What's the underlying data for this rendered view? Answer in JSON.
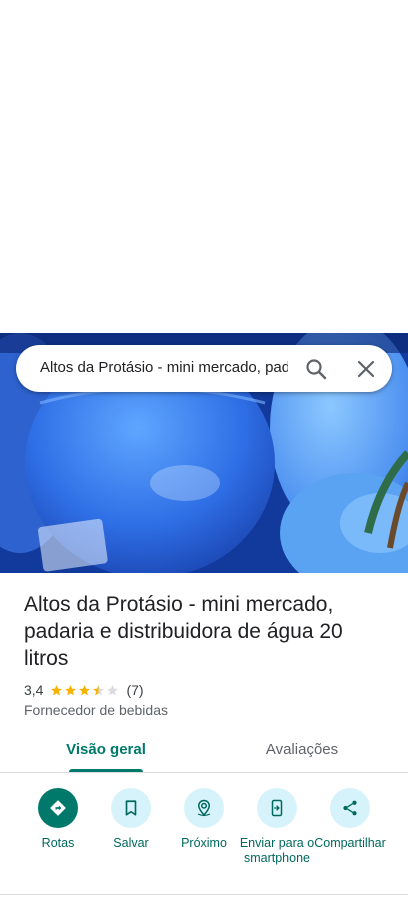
{
  "search": {
    "query": "Altos da Protásio - mini mercado, padaria e distribuidora de água 20 litros",
    "search_icon": "search-icon",
    "close_icon": "close-icon"
  },
  "place": {
    "title": "Altos da Protásio - mini mercado, padaria e distribuidora de água 20 litros",
    "rating": "3,4",
    "rating_value": 3.4,
    "rating_max": 5,
    "review_count": "(7)",
    "category": "Fornecedor de bebidas"
  },
  "tabs": [
    {
      "label": "Visão geral",
      "active": true
    },
    {
      "label": "Avaliações",
      "active": false
    }
  ],
  "actions": [
    {
      "label": "Rotas",
      "icon": "directions-icon"
    },
    {
      "label": "Salvar",
      "icon": "bookmark-icon"
    },
    {
      "label": "Próximo",
      "icon": "nearby-icon"
    },
    {
      "label": "Enviar para o smartphone",
      "icon": "send-to-phone-icon"
    },
    {
      "label": "Compartilhar",
      "icon": "share-icon"
    }
  ],
  "colors": {
    "accent": "#00796b",
    "action_bg": "#d6f3fb",
    "star": "#f4b400",
    "star_empty": "#dadce0"
  }
}
